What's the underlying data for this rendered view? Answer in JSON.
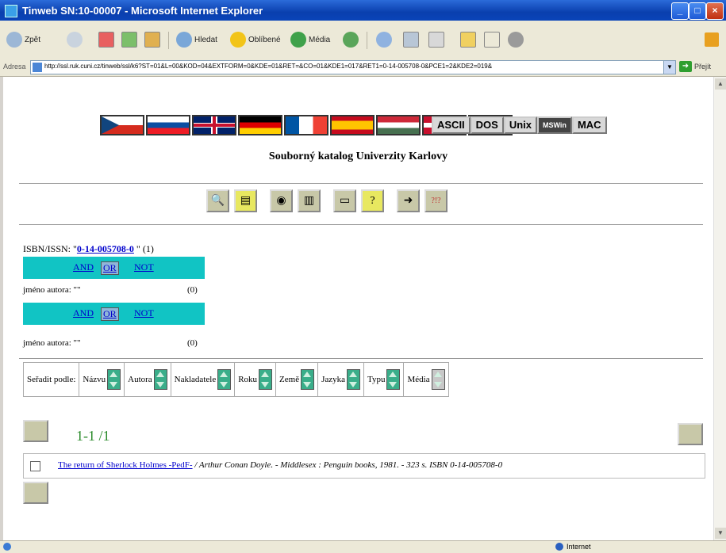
{
  "window": {
    "title": "Tinweb SN:10-00007 - Microsoft Internet Explorer"
  },
  "toolbar": {
    "back": "Zpět",
    "search": "Hledat",
    "favorites": "Oblíbené",
    "media": "Média"
  },
  "address": {
    "label": "Adresa",
    "url": "http://ssl.ruk.cuni.cz/tinweb/ssl/k6?ST=01&L=00&KOD=04&EXTFORM=0&KDE=01&RET=&CO=01&KDE1=017&RET1=0-14-005708-0&PCE1=2&KDE2=019&",
    "go": "Přejít"
  },
  "encodings": [
    "ASCII",
    "DOS",
    "Unix",
    "MSWin",
    "MAC"
  ],
  "page": {
    "catalog_title": "Souborný katalog Univerzity Karlovy"
  },
  "query": {
    "isbn_label": "ISBN/ISSN: \"",
    "isbn_value": "0-14-005708-0",
    "isbn_suffix": " \"",
    "isbn_count": "(1)",
    "ops": [
      "AND",
      "OR",
      "NOT"
    ],
    "author_rows": [
      {
        "label": "jméno autora: \"\"",
        "count": "(0)"
      },
      {
        "label": "jméno autora: \"\"",
        "count": "(0)"
      }
    ]
  },
  "sort": {
    "label": "Seřadit podle:",
    "fields": [
      "Názvu",
      "Autora",
      "Nakladatele",
      "Roku",
      "Země",
      "Jazyka",
      "Typu",
      "Média"
    ]
  },
  "results": {
    "pager": "1-1 /1",
    "items": [
      {
        "title_link": "The return of Sherlock Holmes -PedF-",
        "details": " / Arthur Conan Doyle. - Middlesex : Penguin books, 1981. - 323 s. ISBN 0-14-005708-0"
      }
    ]
  },
  "status": {
    "zone": "Internet"
  }
}
